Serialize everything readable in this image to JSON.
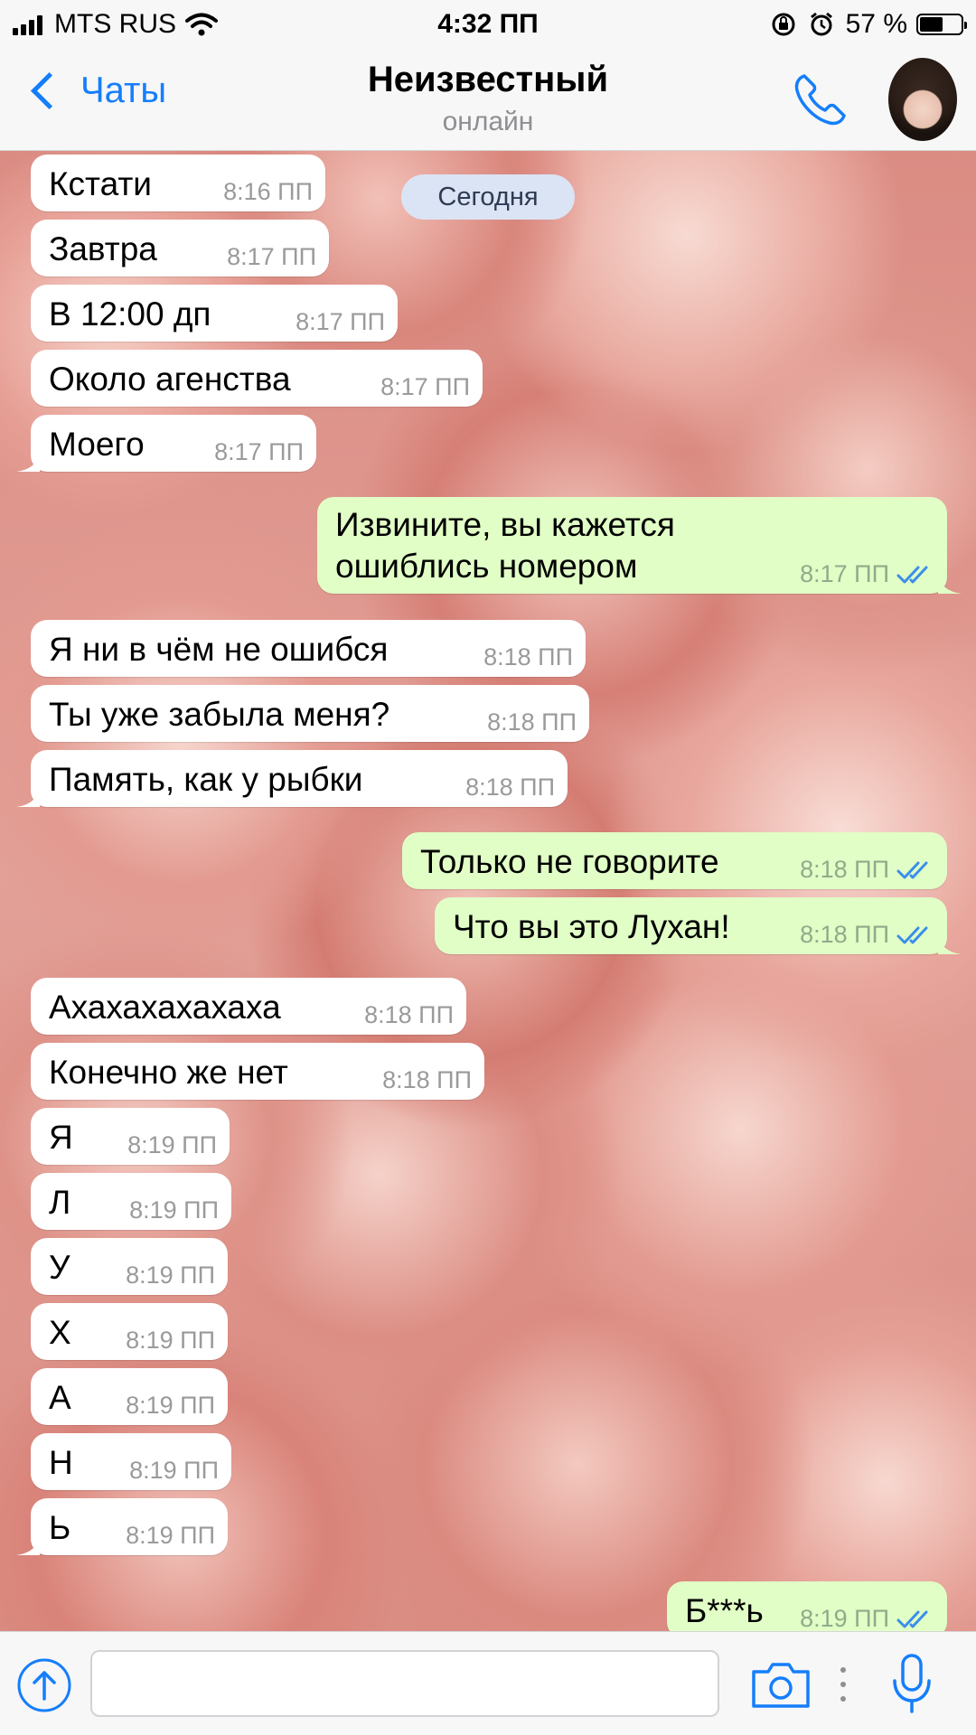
{
  "status_bar": {
    "carrier": "MTS RUS",
    "time": "4:32 ПП",
    "battery": "57 %",
    "battery_level": 0.57
  },
  "nav": {
    "back_label": "Чаты",
    "title": "Неизвестный",
    "subtitle": "онлайн"
  },
  "chat": {
    "date_label": "Сегодня",
    "messages": [
      {
        "dir": "in",
        "text": "Кстати",
        "time": "8:16 ПП"
      },
      {
        "dir": "in",
        "text": "Завтра",
        "time": "8:17 ПП"
      },
      {
        "dir": "in",
        "text": "В 12:00 дп",
        "time": "8:17 ПП"
      },
      {
        "dir": "in",
        "text": "Около агенства",
        "time": "8:17 ПП"
      },
      {
        "dir": "in",
        "text": "Моего",
        "time": "8:17 ПП"
      },
      {
        "dir": "out",
        "text_line1": "Извините, вы кажется",
        "text_line2": "ошиблись номером",
        "time": "8:17 ПП"
      },
      {
        "dir": "in",
        "text": "Я ни в чём не ошибся",
        "time": "8:18 ПП"
      },
      {
        "dir": "in",
        "text": "Ты уже забыла меня?",
        "time": "8:18 ПП"
      },
      {
        "dir": "in",
        "text": "Память, как у рыбки",
        "time": "8:18 ПП"
      },
      {
        "dir": "out",
        "text": "Только не говорите",
        "time": "8:18 ПП"
      },
      {
        "dir": "out",
        "text": "Что вы это Лухан!",
        "time": "8:18 ПП"
      },
      {
        "dir": "in",
        "text": "Ахахахахахаха",
        "time": "8:18 ПП"
      },
      {
        "dir": "in",
        "text": "Конечно же нет",
        "time": "8:18 ПП"
      },
      {
        "dir": "in",
        "text": "Я",
        "time": "8:19 ПП"
      },
      {
        "dir": "in",
        "text": "Л",
        "time": "8:19 ПП"
      },
      {
        "dir": "in",
        "text": "У",
        "time": "8:19 ПП"
      },
      {
        "dir": "in",
        "text": "Х",
        "time": "8:19 ПП"
      },
      {
        "dir": "in",
        "text": "А",
        "time": "8:19 ПП"
      },
      {
        "dir": "in",
        "text": "Н",
        "time": "8:19 ПП"
      },
      {
        "dir": "in",
        "text": "Ь",
        "time": "8:19 ПП"
      },
      {
        "dir": "out",
        "text": "Б***ь",
        "time": "8:19 ПП"
      }
    ]
  },
  "input": {
    "placeholder": ""
  },
  "icons": {
    "signal": "signal-icon",
    "wifi": "wifi-icon",
    "rotation_lock": "rotation-lock-icon",
    "alarm": "alarm-icon",
    "battery": "battery-icon",
    "back": "chevron-left-icon",
    "call": "phone-icon",
    "attach": "upload-arrow-icon",
    "camera": "camera-icon",
    "more": "more-dots-icon",
    "mic": "microphone-icon",
    "read": "double-check-icon"
  },
  "colors": {
    "accent": "#157efb",
    "incoming_bubble": "#ffffff",
    "outgoing_bubble": "#e1fec6",
    "read_ticks": "#3a8eea",
    "date_pill": "#dbe4f5"
  }
}
